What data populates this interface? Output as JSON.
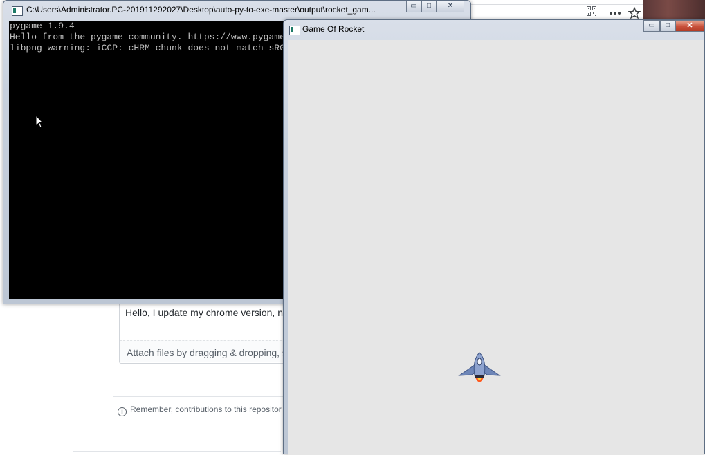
{
  "browser": {
    "qr_icon": "qr-code-icon",
    "more_icon": "more-horizontal-icon",
    "star_icon": "star-icon"
  },
  "github": {
    "comment_text": "Hello, I update my chrome version, no",
    "attach_text": "Attach files by dragging & dropping, s",
    "notice_text": "Remember, contributions to this repositor"
  },
  "console_window": {
    "title": "C:\\Users\\Administrator.PC-201911292027\\Desktop\\auto-py-to-exe-master\\output\\rocket_gam...",
    "lines": [
      "pygame 1.9.4",
      "Hello from the pygame community. https://www.pygame.org/contribute.html",
      "libpng warning: iCCP: cHRM chunk does not match sRGB"
    ],
    "minimize_glyph": "▭",
    "maximize_glyph": "□",
    "close_glyph": "✕"
  },
  "game_window": {
    "title": "Game Of Rocket",
    "minimize_glyph": "▭",
    "maximize_glyph": "□",
    "close_glyph": "✕",
    "background_color": "#e6e6e6"
  },
  "colors": {
    "console_bg": "#000000",
    "console_text": "#c0c0c0",
    "rocket_body": "#6e86b8",
    "rocket_flame": "#ff5a1f"
  }
}
